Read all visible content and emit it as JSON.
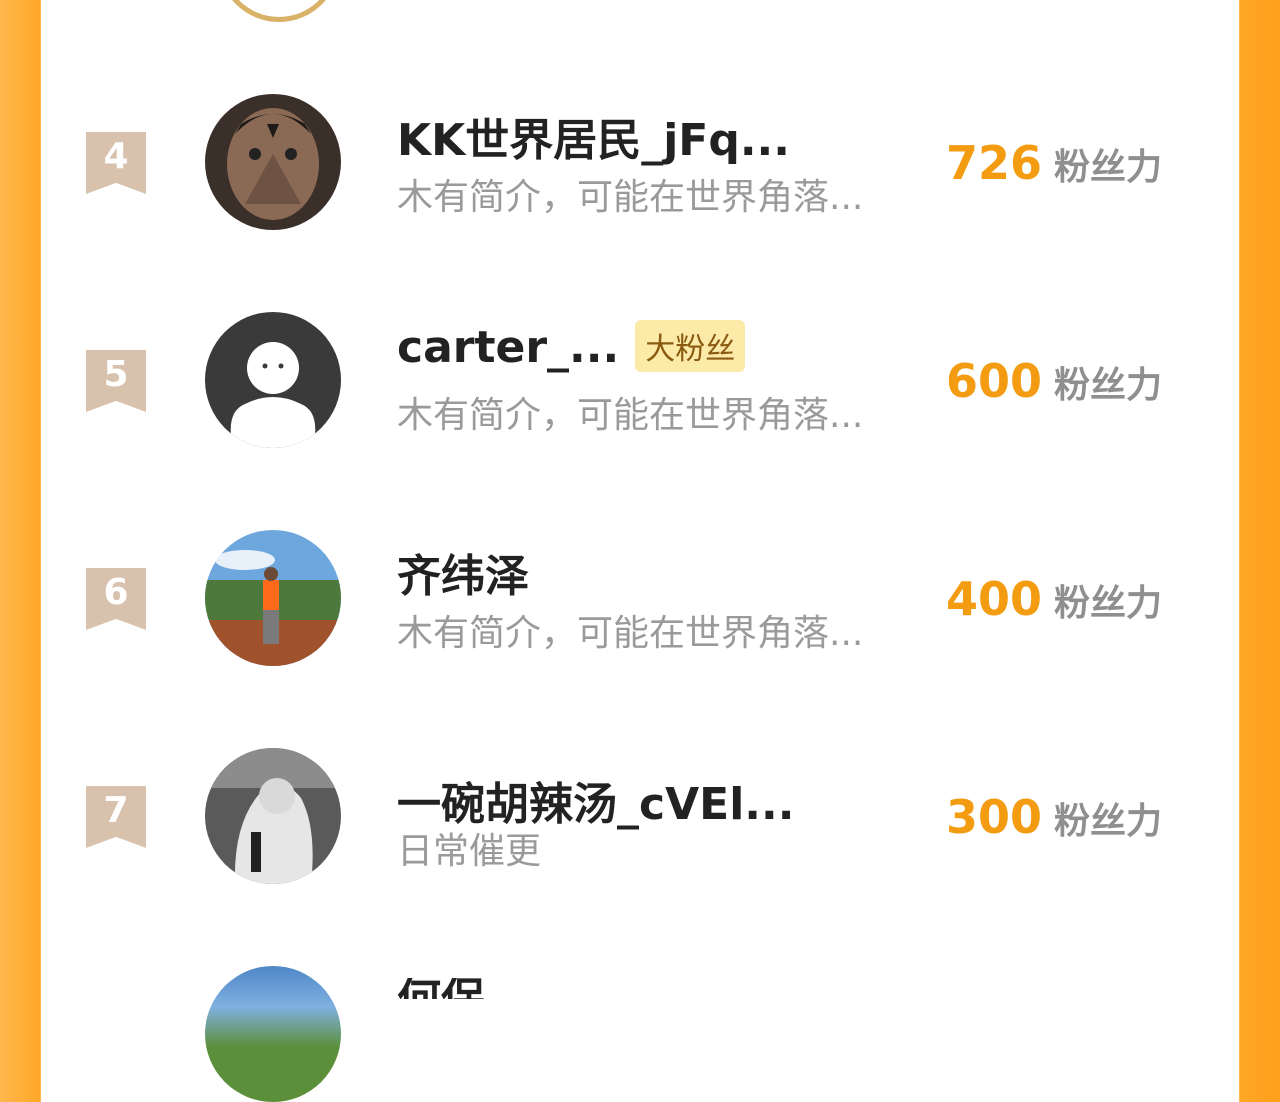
{
  "score_unit": "粉丝力",
  "rows": [
    {
      "rank": "4",
      "name": "KK世界居民_jFq...",
      "badge": "",
      "bio": "木有简介，可能在世界角落...",
      "score": "726"
    },
    {
      "rank": "5",
      "name": "carter_...",
      "badge": "大粉丝",
      "bio": "木有简介，可能在世界角落...",
      "score": "600"
    },
    {
      "rank": "6",
      "name": "齐纬泽",
      "badge": "",
      "bio": "木有简介，可能在世界角落...",
      "score": "400"
    },
    {
      "rank": "7",
      "name": "一碗胡辣汤_cVEl...",
      "badge": "",
      "bio": "日常催更",
      "score": "300"
    }
  ],
  "next_row": {
    "name": "何保"
  },
  "colors": {
    "accent": "#f39c12",
    "rank_badge": "#d8c2ad",
    "fan_badge": "#fbeaa8",
    "side_bar": "#ffa726"
  },
  "icons": [
    "rank-ribbon-icon",
    "default-avatar-icon"
  ]
}
